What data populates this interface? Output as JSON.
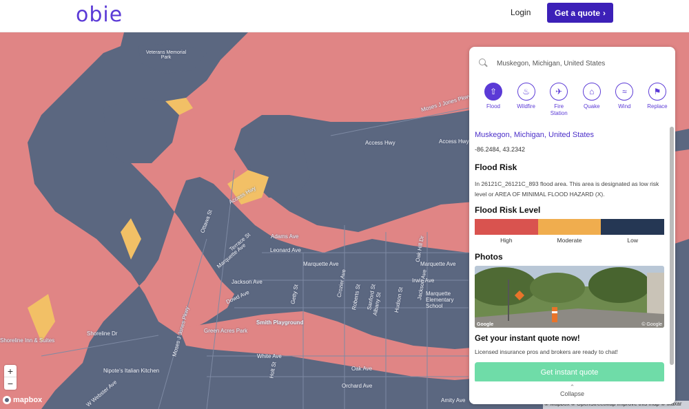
{
  "header": {
    "logo_text": "obie",
    "login_label": "Login",
    "quote_button_label": "Get a quote"
  },
  "map": {
    "labels": [
      "Veterans Memorial Park",
      "Moses J Jones Pkwy",
      "Access Hwy",
      "Access Hwy",
      "Access Hwy",
      "Ottawa St",
      "Terrace St",
      "Adams Ave",
      "Leonard Ave",
      "Marquette Ave",
      "Marquette Ave",
      "Marquette Ave",
      "Irwin Ave",
      "Jackson Ave",
      "Jackson Ave",
      "Dowd Ave",
      "Crozier Ave",
      "Roberts St",
      "Sanford St",
      "Smith Playground",
      "Green Acres Park",
      "Marquette Elementary School",
      "Shoreline Dr",
      "Shoreline Inn & Suites",
      "Nipote's Italian Kitchen",
      "W Webster Ave",
      "White Ave",
      "Oak Ave",
      "Orchard Ave",
      "Amity Ave",
      "Oak Hill Dr",
      "Moses J Jones Pkwy",
      "Holt St",
      "Albany St",
      "Hudson St",
      "Getty St"
    ],
    "zoom_in_label": "+",
    "zoom_out_label": "−",
    "mapbox_label": "mapbox",
    "attribution": "© Mapbox © OpenStreetMap Improve this map © Maxar"
  },
  "panel": {
    "search_value": "Muskegon, Michigan, United States",
    "tabs": [
      {
        "label": "Flood",
        "icon": "flood-icon",
        "active": true
      },
      {
        "label": "Wildfire",
        "icon": "wildfire-icon",
        "active": false
      },
      {
        "label": "Fire Station",
        "icon": "fire-station-icon",
        "active": false
      },
      {
        "label": "Quake",
        "icon": "quake-icon",
        "active": false
      },
      {
        "label": "Wind",
        "icon": "wind-icon",
        "active": false
      },
      {
        "label": "Replace",
        "icon": "replace-icon",
        "active": false
      }
    ],
    "address_link": "Muskegon, Michigan, United States",
    "coordinates": "-86.2484, 43.2342",
    "flood_risk_title": "Flood Risk",
    "flood_risk_desc": "In 26121C_26121C_893 flood area. This area is designated as low risk level or AREA OF MINIMAL FLOOD HAZARD (X).",
    "risk_level_title": "Flood Risk Level",
    "risk_levels": [
      {
        "label": "High",
        "color": "#d9534f"
      },
      {
        "label": "Moderate",
        "color": "#f0ad4e"
      },
      {
        "label": "Low",
        "color": "#253754"
      }
    ],
    "photos_title": "Photos",
    "photo_credit": "Google",
    "photo_credit_right": "© Google",
    "cta_title": "Get your instant quote now!",
    "cta_desc": "Licensed insurance pros and brokers are ready to chat!",
    "cta_button": "Get instant quote",
    "collapse_label": "Collapse"
  },
  "colors": {
    "brand": "#3c20b8",
    "accent": "#5b3ad6",
    "flood_high": "#e08585",
    "flood_moderate": "#f2c066",
    "land": "#5b6780"
  }
}
